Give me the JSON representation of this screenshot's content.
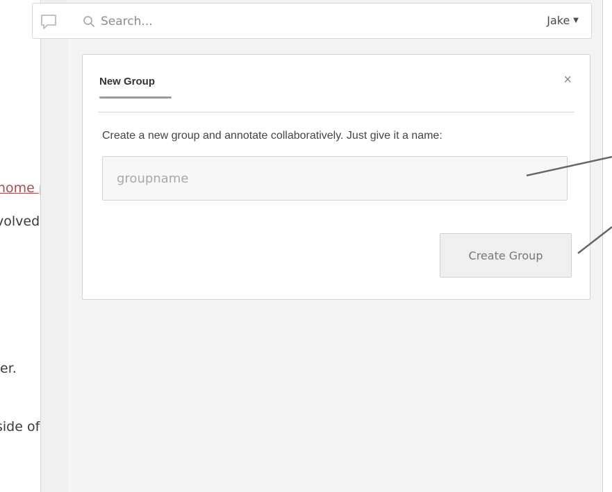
{
  "background_page": {
    "link_text": "home p",
    "line2": "volved",
    "line3": "er.",
    "line4": "side of"
  },
  "topbar": {
    "comment_icon": "speech-bubble-icon",
    "search_icon": "search-icon",
    "search_placeholder": "Search...",
    "user_name": "Jake",
    "user_caret": "▼"
  },
  "new_group": {
    "tab_label": "New Group",
    "close_label": "×",
    "instructions": "Create a new group and annotate collaboratively. Just give it a name:",
    "input_placeholder": "groupname",
    "input_value": "",
    "create_button_label": "Create Group"
  },
  "colors": {
    "link": "#b04a4a",
    "sidebar_bg": "#f3f3f3",
    "card_bg": "#ffffff",
    "button_bg": "#efefef"
  }
}
